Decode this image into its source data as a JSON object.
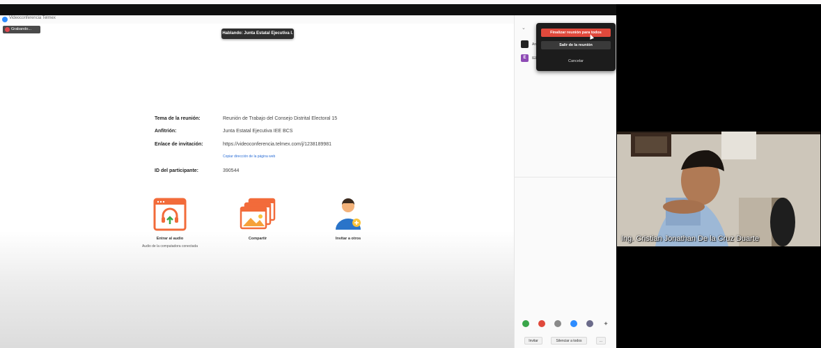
{
  "app": {
    "title": "Videoconferencia Telmex",
    "recording_label": "Grabando...",
    "speaking_label": "Hablando: Junta Estatal Ejecutiva I."
  },
  "meeting_info": {
    "topic_label": "Tema de la reunión:",
    "topic_value": "Reunión de Trabajo del Consejo Distrital Electoral 15",
    "host_label": "Anfitrión:",
    "host_value": "Junta Estatal Ejecutiva IEE BCS",
    "invite_label": "Enlace de invitación:",
    "invite_value": "https://videoconferencia.telmex.com/j/1238189981",
    "copy_link": "Copiar dirección de la página web",
    "participant_id_label": "ID del participante:",
    "participant_id_value": "390544"
  },
  "actions": {
    "audio_label": "Entrar al audio",
    "audio_sub": "Audio de la computadora conectada",
    "share_label": "Compartir",
    "invite_label": "Invitar a otros"
  },
  "participants_panel": {
    "items": [
      {
        "initial": "",
        "name": "An",
        "color": "#222222"
      },
      {
        "initial": "E",
        "name": "IEE",
        "color": "#8e4bb5"
      }
    ],
    "invite_button": "Invitar",
    "mute_all_button": "Silenciar a todos",
    "more_button": "..."
  },
  "end_dialog": {
    "end_for_all": "Finalizar reunión para todos",
    "leave": "Salir de la reunión",
    "cancel": "Cancelar"
  },
  "video": {
    "participant_name": "Ing. Cristian Jonathan De la Cruz Duarte"
  },
  "colors": {
    "accent_red": "#e0493c",
    "link_blue": "#2d6fd6",
    "orange_icon": "#f26b3a"
  }
}
